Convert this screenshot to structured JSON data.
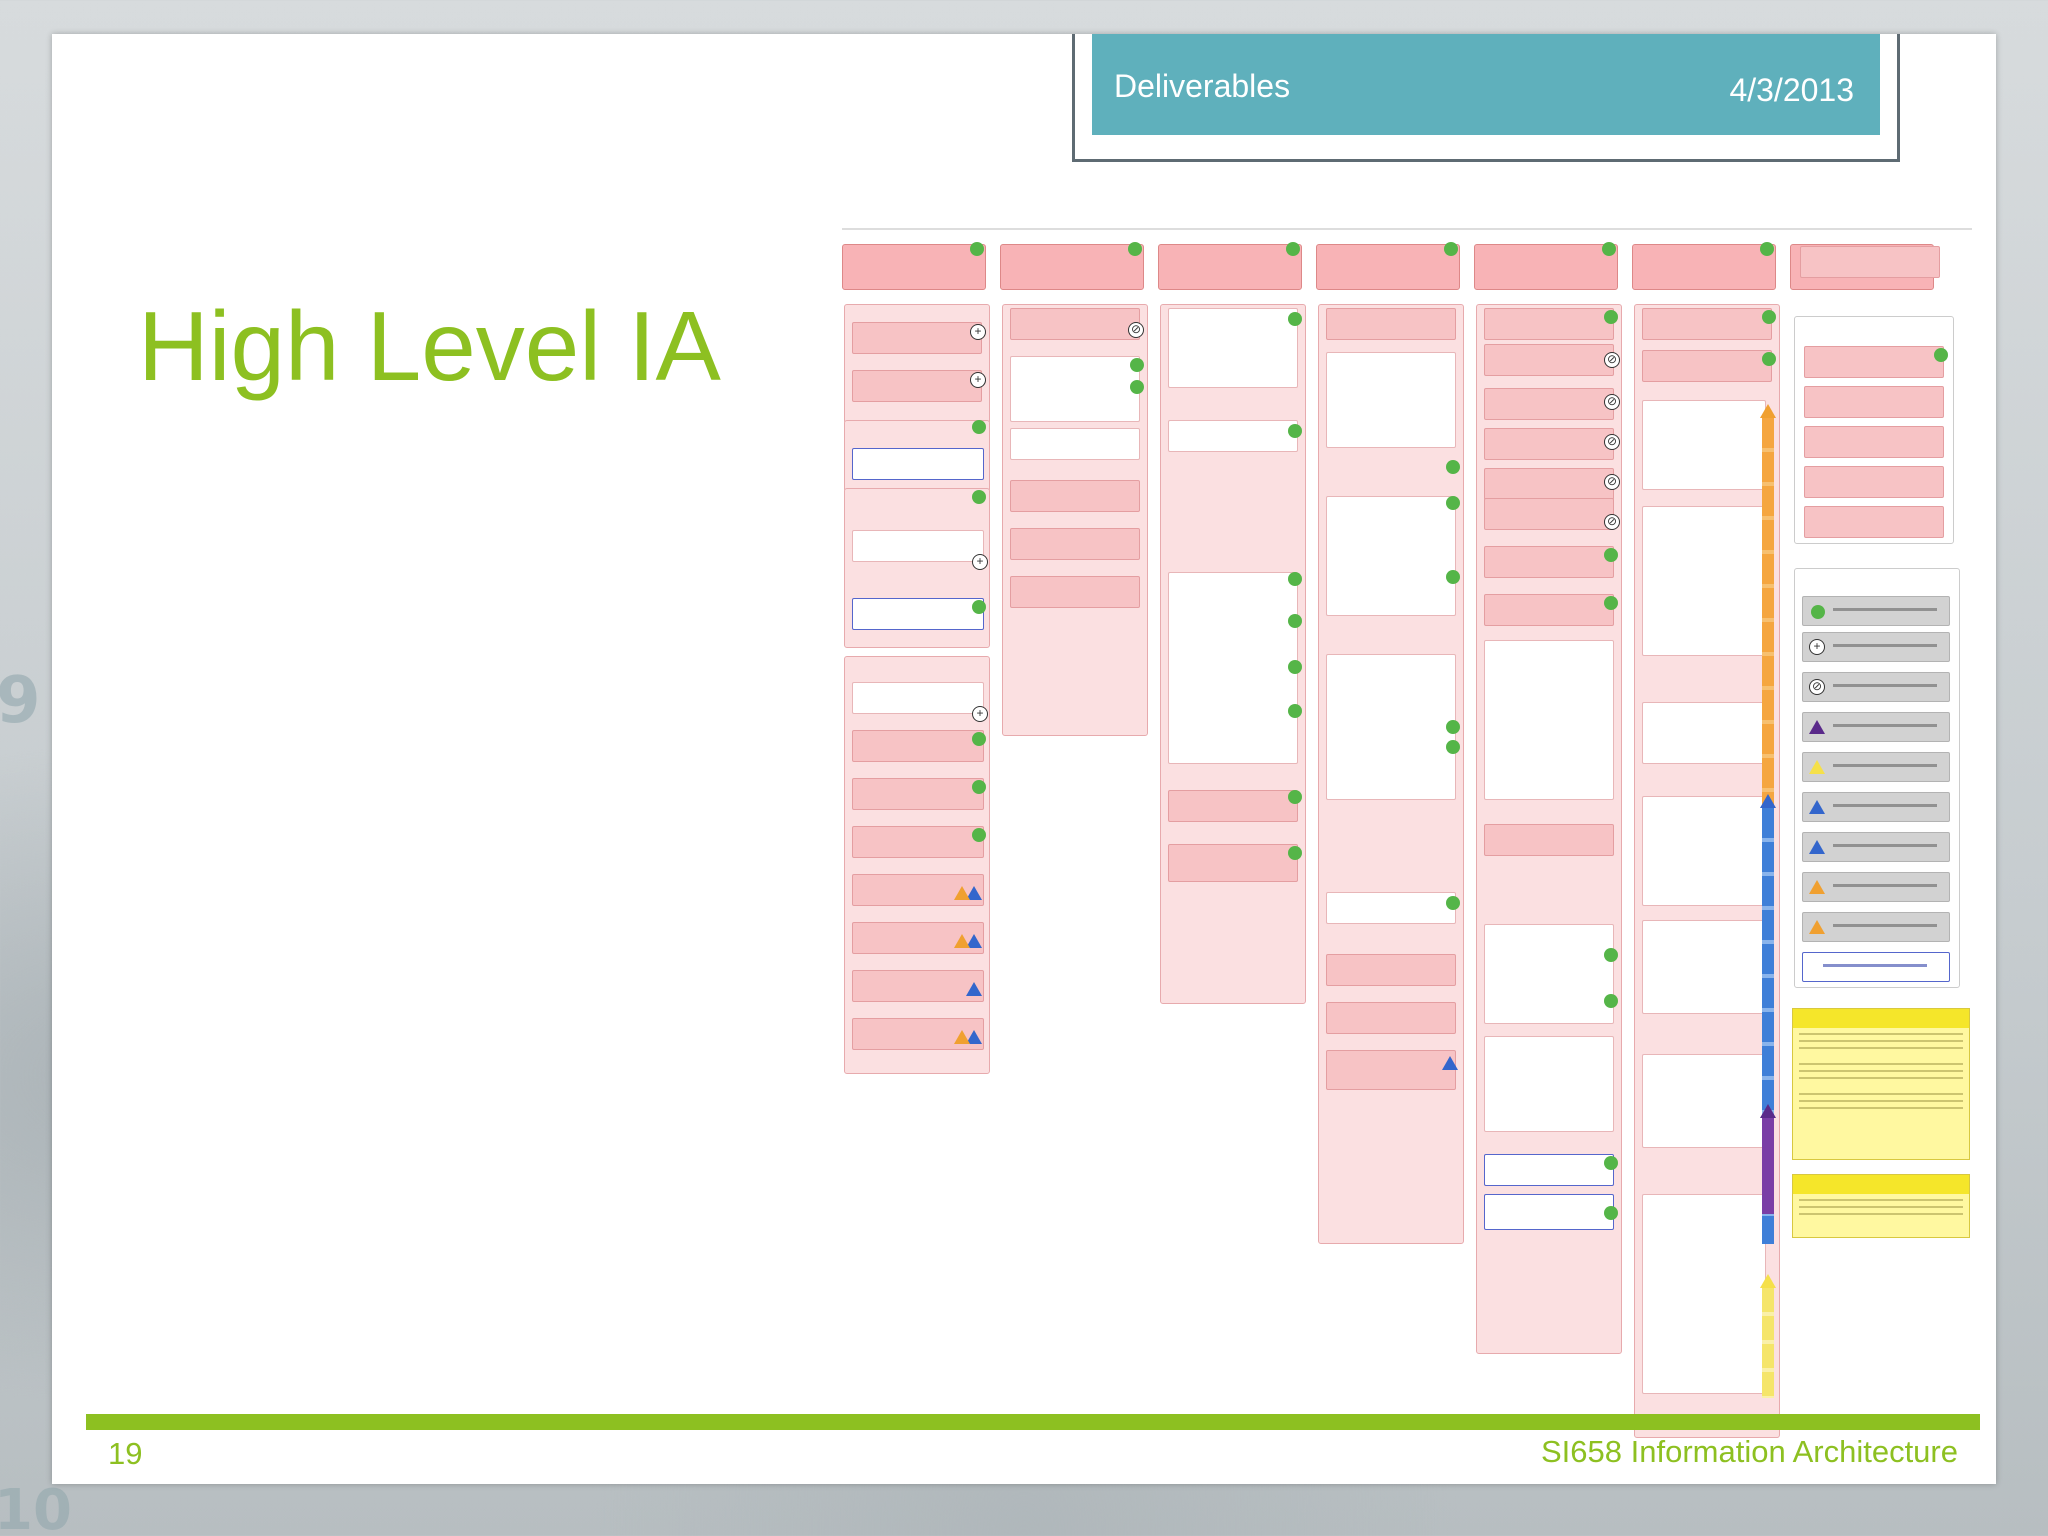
{
  "header": {
    "section": "Deliverables",
    "date": "4/3/2013"
  },
  "slide": {
    "title": "High Level IA",
    "page_number": "19",
    "course": "SI658 Information Architecture"
  },
  "background_numbers": [
    "9",
    "10"
  ],
  "colors": {
    "accent_green": "#8DC021",
    "header_teal": "#5FB0BC",
    "node_pink": "#F7C3C5",
    "node_border": "#E49EA1",
    "new_content": "#55B548"
  },
  "icons": [
    "plus-icon",
    "cross-link-icon",
    "triangle-icon",
    "new-content-dot-icon"
  ]
}
